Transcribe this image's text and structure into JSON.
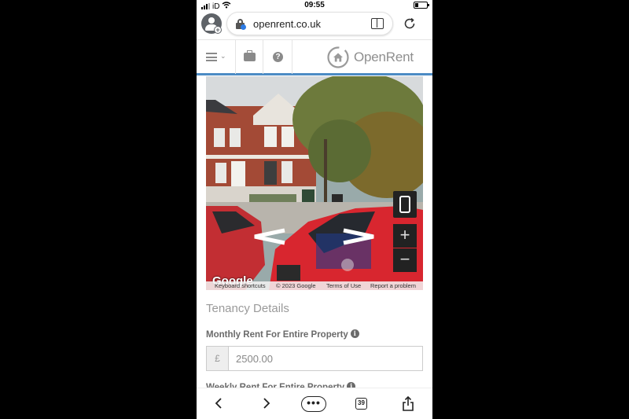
{
  "status_bar": {
    "carrier": "iD",
    "time": "09:55"
  },
  "browser": {
    "url": "openrent.co.uk",
    "open_tabs": "39",
    "more_label": "•••"
  },
  "site": {
    "logo_text": "OpenRent",
    "menu_chevron": "⌄",
    "help_symbol": "?"
  },
  "street_view": {
    "google_label": "Google",
    "footer": {
      "keyboard": "Keyboard shortcuts",
      "copyright": "© 2023 Google",
      "terms": "Terms of Use",
      "report": "Report a problem"
    },
    "zoom_in": "+",
    "zoom_out": "−"
  },
  "form": {
    "section_heading": "Tenancy Details",
    "monthly_label": "Monthly Rent For Entire Property",
    "currency_symbol": "£",
    "monthly_value": "2500.00",
    "weekly_label": "Weekly Rent For Entire Property",
    "info_symbol": "i"
  },
  "colors": {
    "accent": "#4c8bc4",
    "logo_grey": "#8f8f8f"
  }
}
